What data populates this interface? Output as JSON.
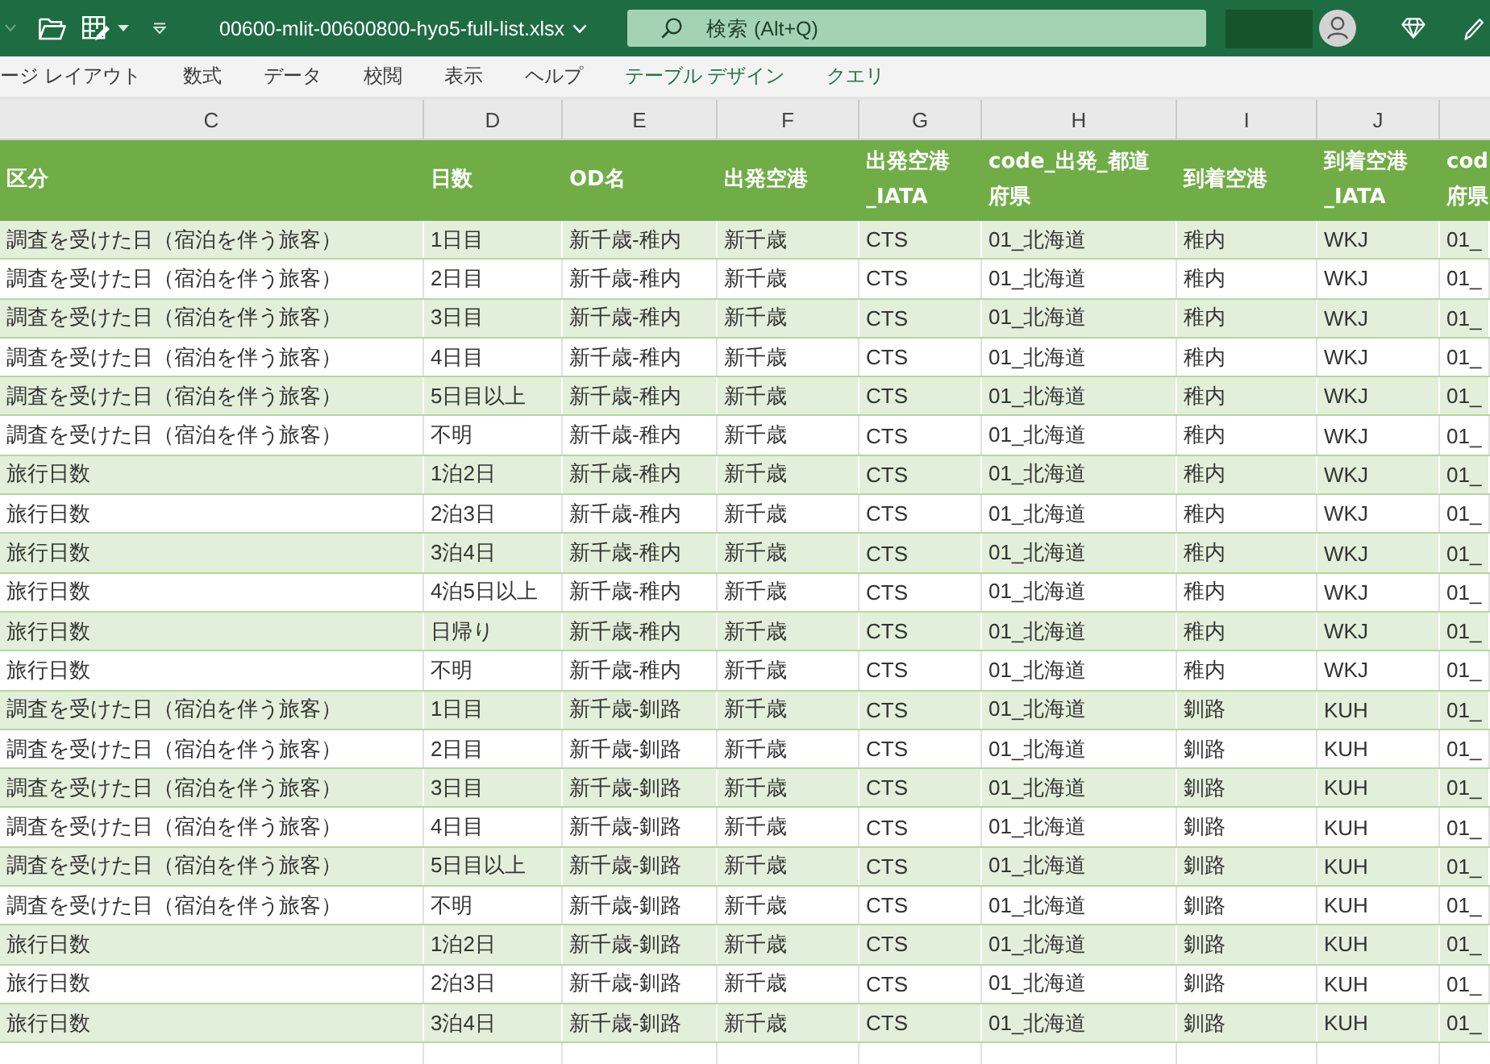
{
  "title_bar": {
    "file_name": "00600-mlit-00600800-hyo5-full-list.xlsx",
    "search": {
      "placeholder": "検索 (Alt+Q)"
    }
  },
  "ribbon_tabs": [
    {
      "label": "ージ レイアウト",
      "kind": "standard"
    },
    {
      "label": "数式",
      "kind": "standard"
    },
    {
      "label": "データ",
      "kind": "standard"
    },
    {
      "label": "校閲",
      "kind": "standard"
    },
    {
      "label": "表示",
      "kind": "standard"
    },
    {
      "label": "ヘルプ",
      "kind": "standard"
    },
    {
      "label": "テーブル デザイン",
      "kind": "contextual"
    },
    {
      "label": "クエリ",
      "kind": "contextual"
    }
  ],
  "column_letters": [
    "C",
    "D",
    "E",
    "F",
    "G",
    "H",
    "I",
    "J"
  ],
  "table": {
    "header": [
      {
        "lines": [
          "区分"
        ]
      },
      {
        "lines": [
          "日数"
        ]
      },
      {
        "lines": [
          "OD名"
        ]
      },
      {
        "lines": [
          "出発空港"
        ]
      },
      {
        "lines": [
          "出発空港",
          "_IATA"
        ]
      },
      {
        "lines": [
          "code_出発_都道",
          "府県"
        ]
      },
      {
        "lines": [
          "到着空港"
        ]
      },
      {
        "lines": [
          "到着空港",
          "_IATA"
        ]
      },
      {
        "lines": [
          "cod",
          "府県"
        ]
      }
    ],
    "rows": [
      [
        "調査を受けた日（宿泊を伴う旅客）",
        "1日目",
        "新千歳-稚内",
        "新千歳",
        "CTS",
        "01_北海道",
        "稚内",
        "WKJ",
        "01_"
      ],
      [
        "調査を受けた日（宿泊を伴う旅客）",
        "2日目",
        "新千歳-稚内",
        "新千歳",
        "CTS",
        "01_北海道",
        "稚内",
        "WKJ",
        "01_"
      ],
      [
        "調査を受けた日（宿泊を伴う旅客）",
        "3日目",
        "新千歳-稚内",
        "新千歳",
        "CTS",
        "01_北海道",
        "稚内",
        "WKJ",
        "01_"
      ],
      [
        "調査を受けた日（宿泊を伴う旅客）",
        "4日目",
        "新千歳-稚内",
        "新千歳",
        "CTS",
        "01_北海道",
        "稚内",
        "WKJ",
        "01_"
      ],
      [
        "調査を受けた日（宿泊を伴う旅客）",
        "5日目以上",
        "新千歳-稚内",
        "新千歳",
        "CTS",
        "01_北海道",
        "稚内",
        "WKJ",
        "01_"
      ],
      [
        "調査を受けた日（宿泊を伴う旅客）",
        "不明",
        "新千歳-稚内",
        "新千歳",
        "CTS",
        "01_北海道",
        "稚内",
        "WKJ",
        "01_"
      ],
      [
        "旅行日数",
        "1泊2日",
        "新千歳-稚内",
        "新千歳",
        "CTS",
        "01_北海道",
        "稚内",
        "WKJ",
        "01_"
      ],
      [
        "旅行日数",
        "2泊3日",
        "新千歳-稚内",
        "新千歳",
        "CTS",
        "01_北海道",
        "稚内",
        "WKJ",
        "01_"
      ],
      [
        "旅行日数",
        "3泊4日",
        "新千歳-稚内",
        "新千歳",
        "CTS",
        "01_北海道",
        "稚内",
        "WKJ",
        "01_"
      ],
      [
        "旅行日数",
        "4泊5日以上",
        "新千歳-稚内",
        "新千歳",
        "CTS",
        "01_北海道",
        "稚内",
        "WKJ",
        "01_"
      ],
      [
        "旅行日数",
        "日帰り",
        "新千歳-稚内",
        "新千歳",
        "CTS",
        "01_北海道",
        "稚内",
        "WKJ",
        "01_"
      ],
      [
        "旅行日数",
        "不明",
        "新千歳-稚内",
        "新千歳",
        "CTS",
        "01_北海道",
        "稚内",
        "WKJ",
        "01_"
      ],
      [
        "調査を受けた日（宿泊を伴う旅客）",
        "1日目",
        "新千歳-釧路",
        "新千歳",
        "CTS",
        "01_北海道",
        "釧路",
        "KUH",
        "01_"
      ],
      [
        "調査を受けた日（宿泊を伴う旅客）",
        "2日目",
        "新千歳-釧路",
        "新千歳",
        "CTS",
        "01_北海道",
        "釧路",
        "KUH",
        "01_"
      ],
      [
        "調査を受けた日（宿泊を伴う旅客）",
        "3日目",
        "新千歳-釧路",
        "新千歳",
        "CTS",
        "01_北海道",
        "釧路",
        "KUH",
        "01_"
      ],
      [
        "調査を受けた日（宿泊を伴う旅客）",
        "4日目",
        "新千歳-釧路",
        "新千歳",
        "CTS",
        "01_北海道",
        "釧路",
        "KUH",
        "01_"
      ],
      [
        "調査を受けた日（宿泊を伴う旅客）",
        "5日目以上",
        "新千歳-釧路",
        "新千歳",
        "CTS",
        "01_北海道",
        "釧路",
        "KUH",
        "01_"
      ],
      [
        "調査を受けた日（宿泊を伴う旅客）",
        "不明",
        "新千歳-釧路",
        "新千歳",
        "CTS",
        "01_北海道",
        "釧路",
        "KUH",
        "01_"
      ],
      [
        "旅行日数",
        "1泊2日",
        "新千歳-釧路",
        "新千歳",
        "CTS",
        "01_北海道",
        "釧路",
        "KUH",
        "01_"
      ],
      [
        "旅行日数",
        "2泊3日",
        "新千歳-釧路",
        "新千歳",
        "CTS",
        "01_北海道",
        "釧路",
        "KUH",
        "01_"
      ],
      [
        "旅行日数",
        "3泊4日",
        "新千歳-釧路",
        "新千歳",
        "CTS",
        "01_北海道",
        "釧路",
        "KUH",
        "01_"
      ]
    ]
  }
}
